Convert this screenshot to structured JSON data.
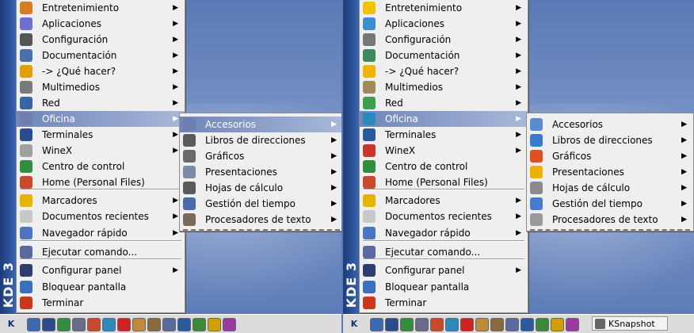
{
  "left": {
    "side_text": "KDE 3",
    "main_items": [
      {
        "label": "Entretenimiento",
        "arrow": true,
        "icon": "hand-icon",
        "color": "#d97c1f"
      },
      {
        "label": "Aplicaciones",
        "arrow": true,
        "icon": "apps-icon",
        "color": "#6f6fd0"
      },
      {
        "label": "Configuración",
        "arrow": true,
        "icon": "sliders-icon",
        "color": "#555555"
      },
      {
        "label": "Documentación",
        "arrow": true,
        "icon": "lifebuoy-icon",
        "color": "#4a6fb0"
      },
      {
        "label": "-> ¿Qué hacer?",
        "arrow": true,
        "icon": "star-icon",
        "color": "#e0a000"
      },
      {
        "label": "Multimedios",
        "arrow": true,
        "icon": "speaker-icon",
        "color": "#7a7a7a"
      },
      {
        "label": "Red",
        "arrow": true,
        "icon": "network-icon",
        "color": "#3b63a8"
      },
      {
        "label": "Oficina",
        "arrow": true,
        "icon": "pen-icon",
        "color": "#6c7fb0",
        "highlighted": true
      },
      {
        "label": "Terminales",
        "arrow": true,
        "icon": "terminal-icon",
        "color": "#2a4b8d"
      },
      {
        "label": "WineX",
        "arrow": true,
        "icon": "wine-icon",
        "color": "#a0a0a0"
      },
      {
        "label": "Centro de control",
        "arrow": false,
        "icon": "control-icon",
        "color": "#2f8f3f"
      },
      {
        "label": "Home (Personal Files)",
        "arrow": false,
        "icon": "home-icon",
        "color": "#c84a2a"
      },
      {
        "label": "Marcadores",
        "arrow": true,
        "icon": "bookmark-star-icon",
        "color": "#e6b400"
      },
      {
        "label": "Documentos recientes",
        "arrow": true,
        "icon": "document-icon",
        "color": "#c8c8c8"
      },
      {
        "label": "Navegador rápido",
        "arrow": true,
        "icon": "quick-nav-icon",
        "color": "#4d74c0"
      },
      {
        "label": "Ejecutar comando...",
        "arrow": false,
        "icon": "run-icon",
        "color": "#5a6aa0"
      },
      {
        "label": "Configurar panel",
        "arrow": true,
        "icon": "panel-icon",
        "color": "#2d3d6d"
      },
      {
        "label": "Bloquear pantalla",
        "arrow": false,
        "icon": "lock-icon",
        "color": "#3a6fc0"
      },
      {
        "label": "Terminar",
        "arrow": false,
        "icon": "logout-icon",
        "color": "#c8381a"
      }
    ],
    "sub_items": [
      {
        "label": "Accesorios",
        "icon": "accessories-icon",
        "color": "#6c7fb0",
        "highlighted": true
      },
      {
        "label": "Libros de direcciones",
        "icon": "address-book-icon",
        "color": "#5a5a5a"
      },
      {
        "label": "Gráficos",
        "icon": "graphics-icon",
        "color": "#6a6a6a"
      },
      {
        "label": "Presentaciones",
        "icon": "presentation-icon",
        "color": "#7a8aaa"
      },
      {
        "label": "Hojas de cálculo",
        "icon": "spreadsheet-icon",
        "color": "#5a5a5a"
      },
      {
        "label": "Gestión del tiempo",
        "icon": "clock-icon",
        "color": "#4a6aa8"
      },
      {
        "label": "Procesadores de texto",
        "icon": "text-processor-icon",
        "color": "#7a6a5a"
      }
    ]
  },
  "right": {
    "side_text": "KDE 3",
    "main_items": [
      {
        "label": "Entretenimiento",
        "arrow": true,
        "icon": "smiley-icon",
        "color": "#f2c200"
      },
      {
        "label": "Aplicaciones",
        "arrow": true,
        "icon": "window-icon",
        "color": "#3a8ed0"
      },
      {
        "label": "Configuración",
        "arrow": true,
        "icon": "wrench-icon",
        "color": "#777777"
      },
      {
        "label": "Documentación",
        "arrow": true,
        "icon": "book-icon",
        "color": "#3a8a5a"
      },
      {
        "label": "-> ¿Qué hacer?",
        "arrow": true,
        "icon": "star-icon",
        "color": "#f0b400"
      },
      {
        "label": "Multimedios",
        "arrow": true,
        "icon": "multimedia-icon",
        "color": "#a08a5a"
      },
      {
        "label": "Red",
        "arrow": true,
        "icon": "network-icon",
        "color": "#3aa050"
      },
      {
        "label": "Oficina",
        "arrow": true,
        "icon": "globe-icon",
        "color": "#2a8ac0",
        "highlighted": true
      },
      {
        "label": "Terminales",
        "arrow": true,
        "icon": "monitor-icon",
        "color": "#2a5a9a"
      },
      {
        "label": "WineX",
        "arrow": true,
        "icon": "wine-icon",
        "color": "#c8382a"
      },
      {
        "label": "Centro de control",
        "arrow": false,
        "icon": "control-icon",
        "color": "#2f8f3f"
      },
      {
        "label": "Home (Personal Files)",
        "arrow": false,
        "icon": "home-icon",
        "color": "#c84a2a"
      },
      {
        "label": "Marcadores",
        "arrow": true,
        "icon": "bookmark-star-icon",
        "color": "#e6b400"
      },
      {
        "label": "Documentos recientes",
        "arrow": true,
        "icon": "document-icon",
        "color": "#c8c8c8"
      },
      {
        "label": "Navegador rápido",
        "arrow": true,
        "icon": "quick-nav-icon",
        "color": "#4d74c0"
      },
      {
        "label": "Ejecutar comando...",
        "arrow": false,
        "icon": "run-icon",
        "color": "#5a6aa0"
      },
      {
        "label": "Configurar panel",
        "arrow": true,
        "icon": "panel-icon",
        "color": "#2d3d6d"
      },
      {
        "label": "Bloquear pantalla",
        "arrow": false,
        "icon": "lock-icon",
        "color": "#3a6fc0"
      },
      {
        "label": "Terminar",
        "arrow": false,
        "icon": "logout-icon",
        "color": "#c8381a"
      }
    ],
    "sub_items": [
      {
        "label": "Accesorios",
        "icon": "accessories-icon",
        "color": "#5a8ad0"
      },
      {
        "label": "Libros de direcciones",
        "icon": "address-book-icon",
        "color": "#3a7ad0"
      },
      {
        "label": "Gráficos",
        "icon": "graphics-icon",
        "color": "#e05020"
      },
      {
        "label": "Presentaciones",
        "icon": "presentation-icon",
        "color": "#f0b000"
      },
      {
        "label": "Hojas de cálculo",
        "icon": "spreadsheet-icon",
        "color": "#8a8a8a"
      },
      {
        "label": "Gestión del tiempo",
        "icon": "clock-icon",
        "color": "#4a7ad0"
      },
      {
        "label": "Procesadores de texto",
        "icon": "text-processor-icon",
        "color": "#9a9a9a"
      }
    ]
  },
  "taskbar": {
    "k_button": "K",
    "task_label": "KSnapshot",
    "launchers": [
      {
        "icon": "editor-icon",
        "color": "#3a6ab0"
      },
      {
        "icon": "terminal-icon",
        "color": "#2a4b8d"
      },
      {
        "icon": "control-icon",
        "color": "#2f8f3f"
      },
      {
        "icon": "printer-icon",
        "color": "#6a6a8a"
      },
      {
        "icon": "home-icon",
        "color": "#c84a2a"
      },
      {
        "icon": "globe-icon",
        "color": "#2a8ac0"
      },
      {
        "icon": "opera-icon",
        "color": "#d02020"
      },
      {
        "icon": "tools-icon",
        "color": "#c08a3a"
      },
      {
        "icon": "draw-icon",
        "color": "#8a6a3a"
      },
      {
        "icon": "wine-icon",
        "color": "#5a6aa0"
      },
      {
        "icon": "play-icon",
        "color": "#2a5aa0"
      },
      {
        "icon": "settings-icon",
        "color": "#3a8a3a"
      },
      {
        "icon": "sound-icon",
        "color": "#d0a000"
      },
      {
        "icon": "mail-icon",
        "color": "#9a3aa0"
      }
    ]
  }
}
